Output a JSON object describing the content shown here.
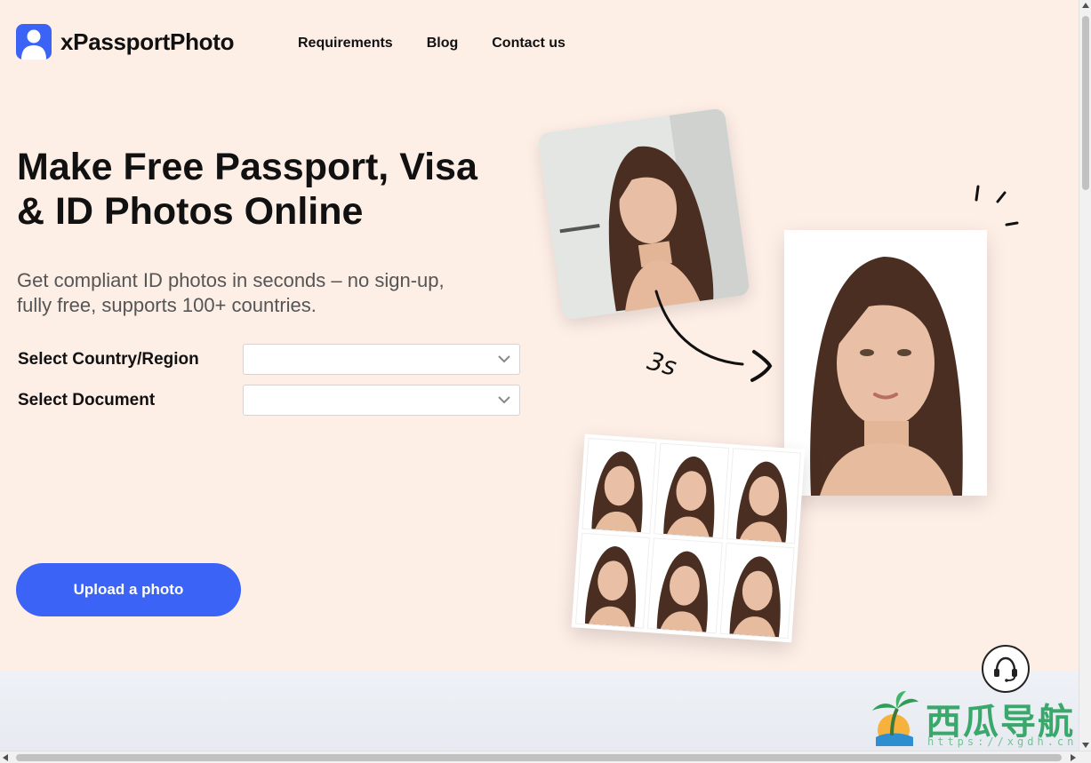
{
  "brand": {
    "name": "xPassportPhoto",
    "accent": "#3b63f5"
  },
  "nav": {
    "items": [
      "Requirements",
      "Blog",
      "Contact us"
    ]
  },
  "hero": {
    "title_line1": "Make Free Passport, Visa",
    "title_line2": "& ID Photos Online",
    "subtitle_line1": "Get compliant ID photos in seconds – no sign-up,",
    "subtitle_line2": "fully free, supports 100+ countries."
  },
  "form": {
    "country_label": "Select Country/Region",
    "country_value": "",
    "document_label": "Select Document",
    "document_value": ""
  },
  "cta": {
    "upload_label": "Upload a photo"
  },
  "illustration": {
    "time_label": "3s"
  },
  "watermark": {
    "text": "西瓜导航",
    "url": "https://xgdh.cn"
  },
  "icons": [
    "user-logo-icon",
    "chevron-down-icon",
    "headset-icon",
    "palm-island-icon"
  ]
}
